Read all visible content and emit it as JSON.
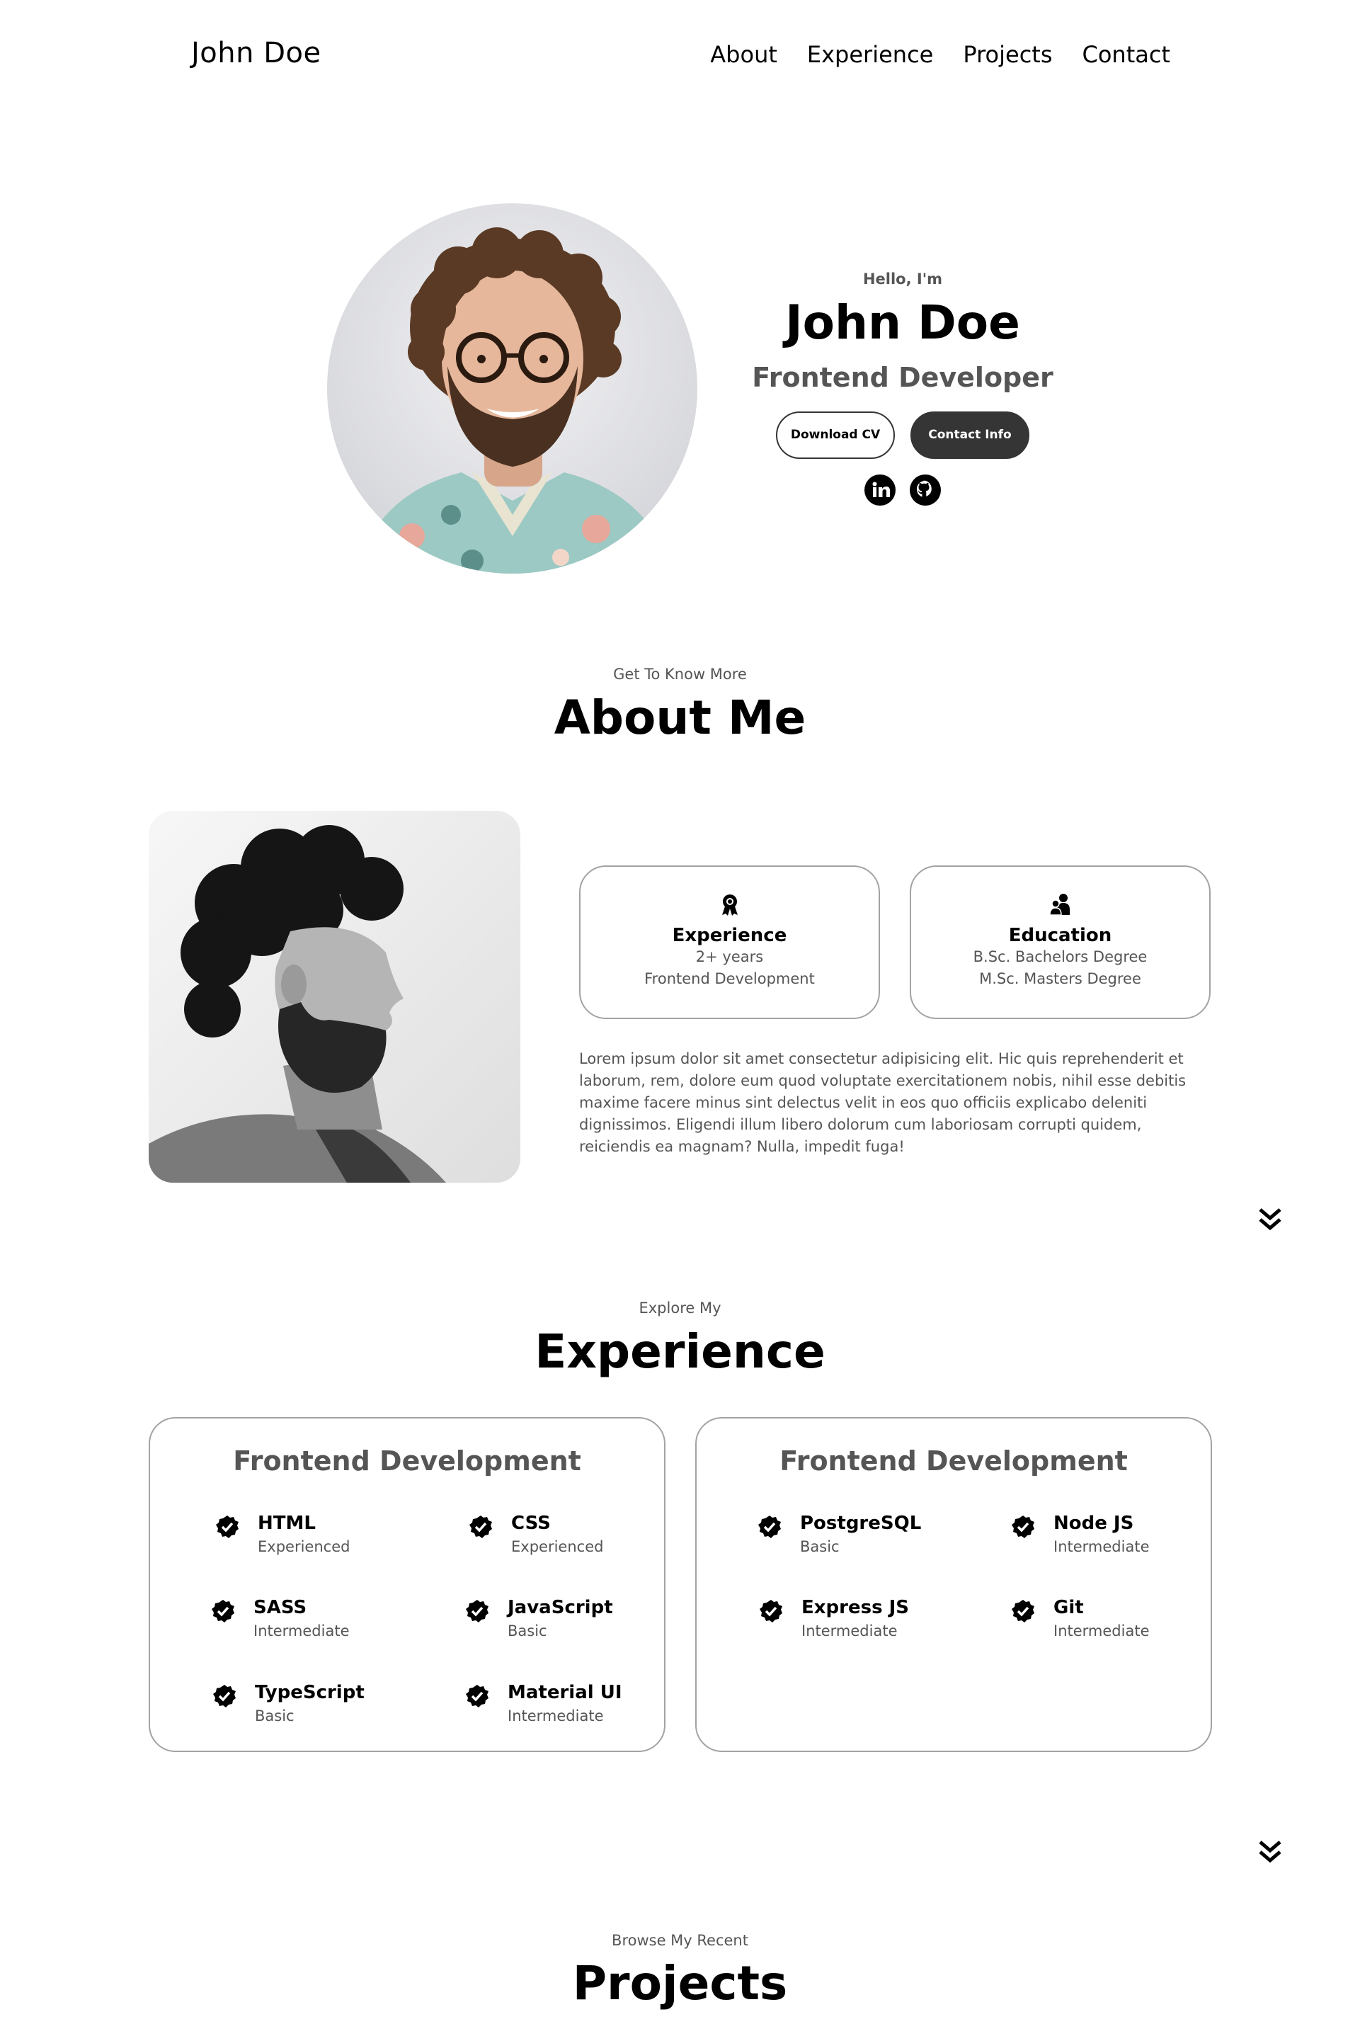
{
  "nav": {
    "logo": "John Doe",
    "links": [
      "About",
      "Experience",
      "Projects",
      "Contact"
    ]
  },
  "hero": {
    "greeting": "Hello, I'm",
    "name": "John Doe",
    "role": "Frontend Developer",
    "download_cv": "Download CV",
    "contact_info": "Contact Info",
    "socials": [
      "linkedin-icon",
      "github-icon"
    ]
  },
  "about": {
    "subtitle": "Get To Know More",
    "title": "About Me",
    "cards": [
      {
        "icon": "award-icon",
        "title": "Experience",
        "lines": [
          "2+ years",
          "Frontend Development"
        ]
      },
      {
        "icon": "education-icon",
        "title": "Education",
        "lines": [
          "B.Sc. Bachelors Degree",
          "M.Sc. Masters Degree"
        ]
      }
    ],
    "text": "Lorem ipsum dolor sit amet consectetur adipisicing elit. Hic quis reprehenderit et laborum, rem, dolore eum quod voluptate exercitationem nobis, nihil esse debitis maxime facere minus sint delectus velit in eos quo officiis explicabo deleniti dignissimos. Eligendi illum libero dolorum cum laboriosam corrupti quidem, reiciendis ea magnam? Nulla, impedit fuga!"
  },
  "experience": {
    "subtitle": "Explore My",
    "title": "Experience",
    "cards": [
      {
        "title": "Frontend Development",
        "skills": [
          {
            "name": "HTML",
            "level": "Experienced"
          },
          {
            "name": "CSS",
            "level": "Experienced"
          },
          {
            "name": "SASS",
            "level": "Intermediate"
          },
          {
            "name": "JavaScript",
            "level": "Basic"
          },
          {
            "name": "TypeScript",
            "level": "Basic"
          },
          {
            "name": "Material UI",
            "level": "Intermediate"
          }
        ]
      },
      {
        "title": "Frontend Development",
        "skills": [
          {
            "name": "PostgreSQL",
            "level": "Basic"
          },
          {
            "name": "Node JS",
            "level": "Intermediate"
          },
          {
            "name": "Express JS",
            "level": "Intermediate"
          },
          {
            "name": "Git",
            "level": "Intermediate"
          }
        ]
      }
    ]
  },
  "projects": {
    "subtitle": "Browse My Recent",
    "title": "Projects"
  },
  "colors": {
    "dark_button": "#353535",
    "muted_text": "#555555",
    "card_border": "#a3a3a3"
  }
}
